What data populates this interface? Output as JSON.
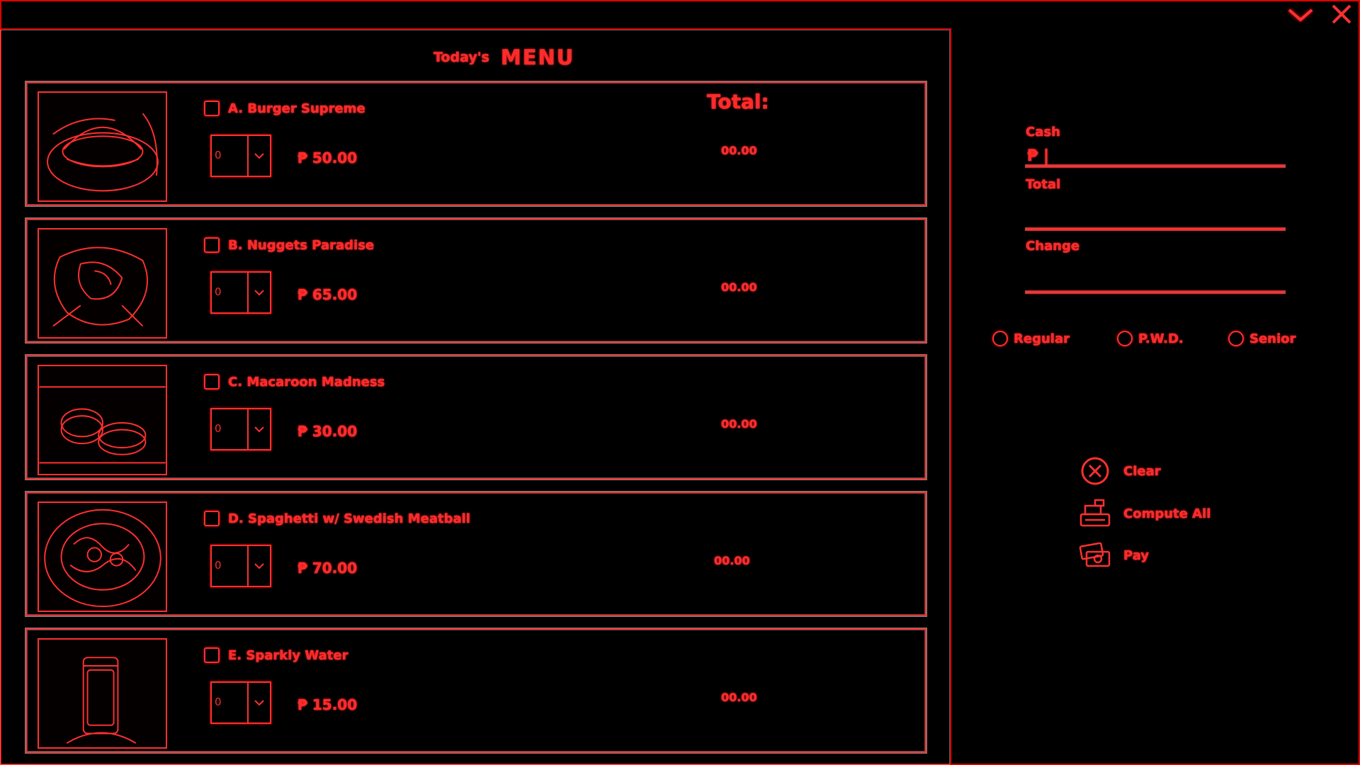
{
  "window": {
    "minimize_icon": "chevron-down-icon",
    "close_icon": "close-icon"
  },
  "menu": {
    "heading_prefix": "Today's",
    "heading": "MENU",
    "total_header": "Total:",
    "items": [
      {
        "label": "A. Burger Supreme",
        "price": "₱ 50.00",
        "total": "00.00",
        "qty": "0"
      },
      {
        "label": "B. Nuggets Paradise",
        "price": "₱ 65.00",
        "total": "00.00",
        "qty": "0"
      },
      {
        "label": "C. Macaroon Madness",
        "price": "₱ 30.00",
        "total": "00.00",
        "qty": "0"
      },
      {
        "label": "D. Spaghetti w/ Swedish Meatball",
        "price": "₱ 70.00",
        "total": "00.00",
        "qty": "0"
      },
      {
        "label": "E. Sparkly Water",
        "price": "₱ 15.00",
        "total": "00.00",
        "qty": "0"
      }
    ]
  },
  "payment": {
    "cash_label": "Cash",
    "cash_value": "₱ |",
    "total_label": "Total",
    "change_label": "Change",
    "discount_options": [
      "Regular",
      "P.W.D.",
      "Senior"
    ]
  },
  "actions": {
    "clear": "Clear",
    "compute": "Compute All",
    "pay": "Pay"
  },
  "colors": {
    "accent": "#ff2a2a",
    "background": "#000000"
  }
}
